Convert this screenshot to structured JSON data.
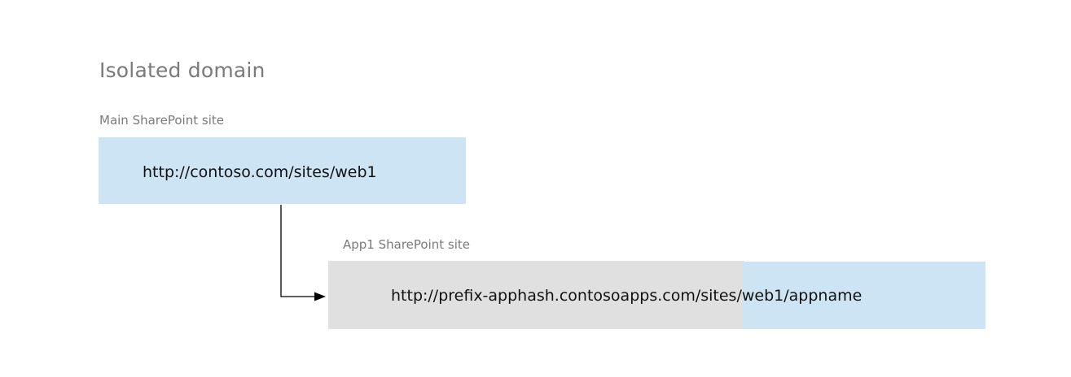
{
  "title": "Isolated domain",
  "main_site": {
    "label": "Main SharePoint site",
    "url": "http://contoso.com/sites/web1"
  },
  "app_site": {
    "label": "App1 SharePoint site",
    "url_domain": "http://prefix-apphash.contosoapps.com",
    "url_path": "/sites/web1/appname"
  },
  "colors": {
    "blue_box": "#cde4f5",
    "gray_box": "#e0e0e0",
    "label_text": "#7a7a7a",
    "connector": "#000000"
  }
}
